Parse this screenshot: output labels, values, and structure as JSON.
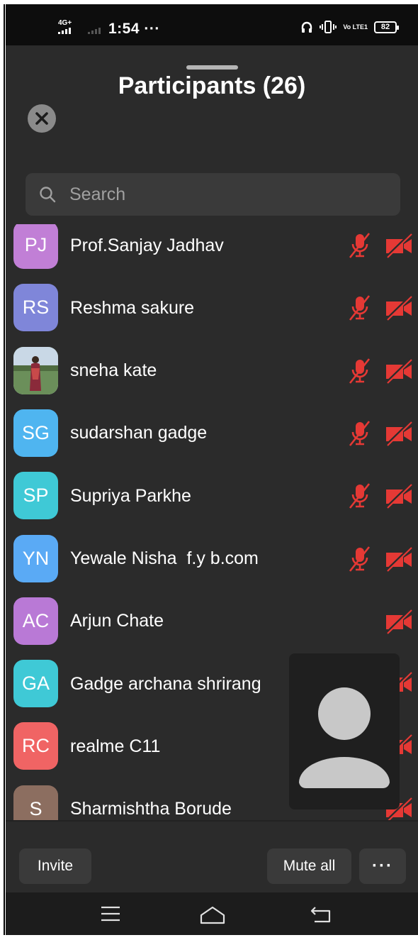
{
  "status_bar": {
    "network": "4G+",
    "time": "1:54",
    "extra": "···",
    "volte": "Vo LTE1",
    "battery": "82"
  },
  "header": {
    "title": "Participants (26)"
  },
  "search": {
    "placeholder": "Search"
  },
  "participants": [
    {
      "initials": "PJ",
      "name": "Prof.Sanjay Jadhav",
      "avatar_color": "#c17fd6",
      "mic_muted": true,
      "cam_off": true
    },
    {
      "initials": "RS",
      "name": "Reshma sakure",
      "avatar_color": "#7f86d9",
      "mic_muted": true,
      "cam_off": true
    },
    {
      "initials": "",
      "name": "sneha kate",
      "avatar_color": "#6b8f5a",
      "photo": true,
      "mic_muted": true,
      "cam_off": true
    },
    {
      "initials": "SG",
      "name": "sudarshan gadge",
      "avatar_color": "#4fb5f0",
      "mic_muted": true,
      "cam_off": true
    },
    {
      "initials": "SP",
      "name": "Supriya Parkhe",
      "avatar_color": "#3fc9d6",
      "mic_muted": true,
      "cam_off": true
    },
    {
      "initials": "YN",
      "name": "Yewale Nisha  f.y b.com",
      "avatar_color": "#5aaaf5",
      "mic_muted": true,
      "cam_off": true
    },
    {
      "initials": "AC",
      "name": "Arjun Chate",
      "avatar_color": "#b979d6",
      "mic_muted": false,
      "cam_off": true
    },
    {
      "initials": "GA",
      "name": "Gadge archana shrirang",
      "avatar_color": "#3fc9d6",
      "mic_muted": false,
      "cam_off": true
    },
    {
      "initials": "RC",
      "name": "realme C11",
      "avatar_color": "#f06464",
      "mic_muted": false,
      "cam_off": true
    },
    {
      "initials": "S",
      "name": "Sharmishtha Borude",
      "avatar_color": "#8c6e60",
      "mic_muted": false,
      "cam_off": true
    }
  ],
  "footer": {
    "invite_label": "Invite",
    "mute_all_label": "Mute all",
    "more_label": "···"
  },
  "colors": {
    "muted_red": "#e53935",
    "background": "#2b2b2b"
  }
}
